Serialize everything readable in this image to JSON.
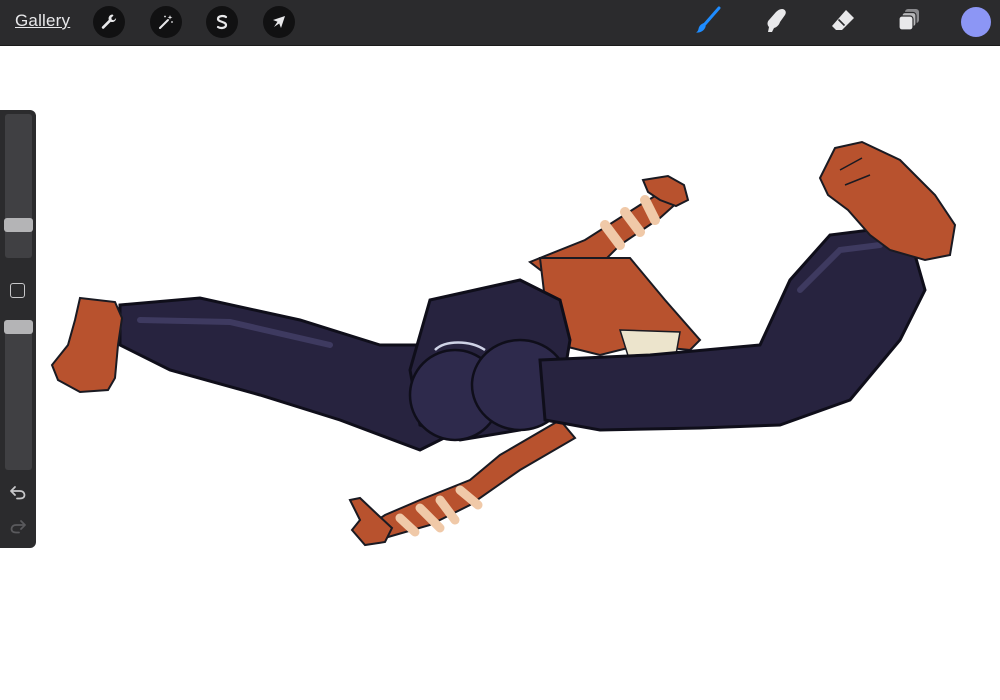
{
  "toolbar": {
    "gallery_label": "Gallery",
    "left_tools": [
      {
        "name": "actions",
        "icon": "wrench-icon"
      },
      {
        "name": "adjustments",
        "icon": "magic-wand-icon"
      },
      {
        "name": "selection",
        "icon": "selection-s-icon"
      },
      {
        "name": "transform",
        "icon": "arrow-cursor-icon"
      }
    ],
    "right_tools": [
      {
        "name": "brush",
        "icon": "brush-icon",
        "active": true
      },
      {
        "name": "smudge",
        "icon": "smudge-finger-icon"
      },
      {
        "name": "eraser",
        "icon": "eraser-icon"
      },
      {
        "name": "layers",
        "icon": "layers-icon"
      }
    ],
    "current_color": "#8c96f5",
    "active_tool_color": "#1e8cff"
  },
  "sidebar": {
    "brush_size_level": 0.2,
    "brush_opacity_level": 0.0,
    "modify_icon": "square-icon",
    "undo_icon": "undo-icon",
    "redo_icon": "redo-icon",
    "redo_enabled": false
  },
  "canvas": {
    "background": "#ffffff",
    "artwork": "figure-illustration"
  }
}
